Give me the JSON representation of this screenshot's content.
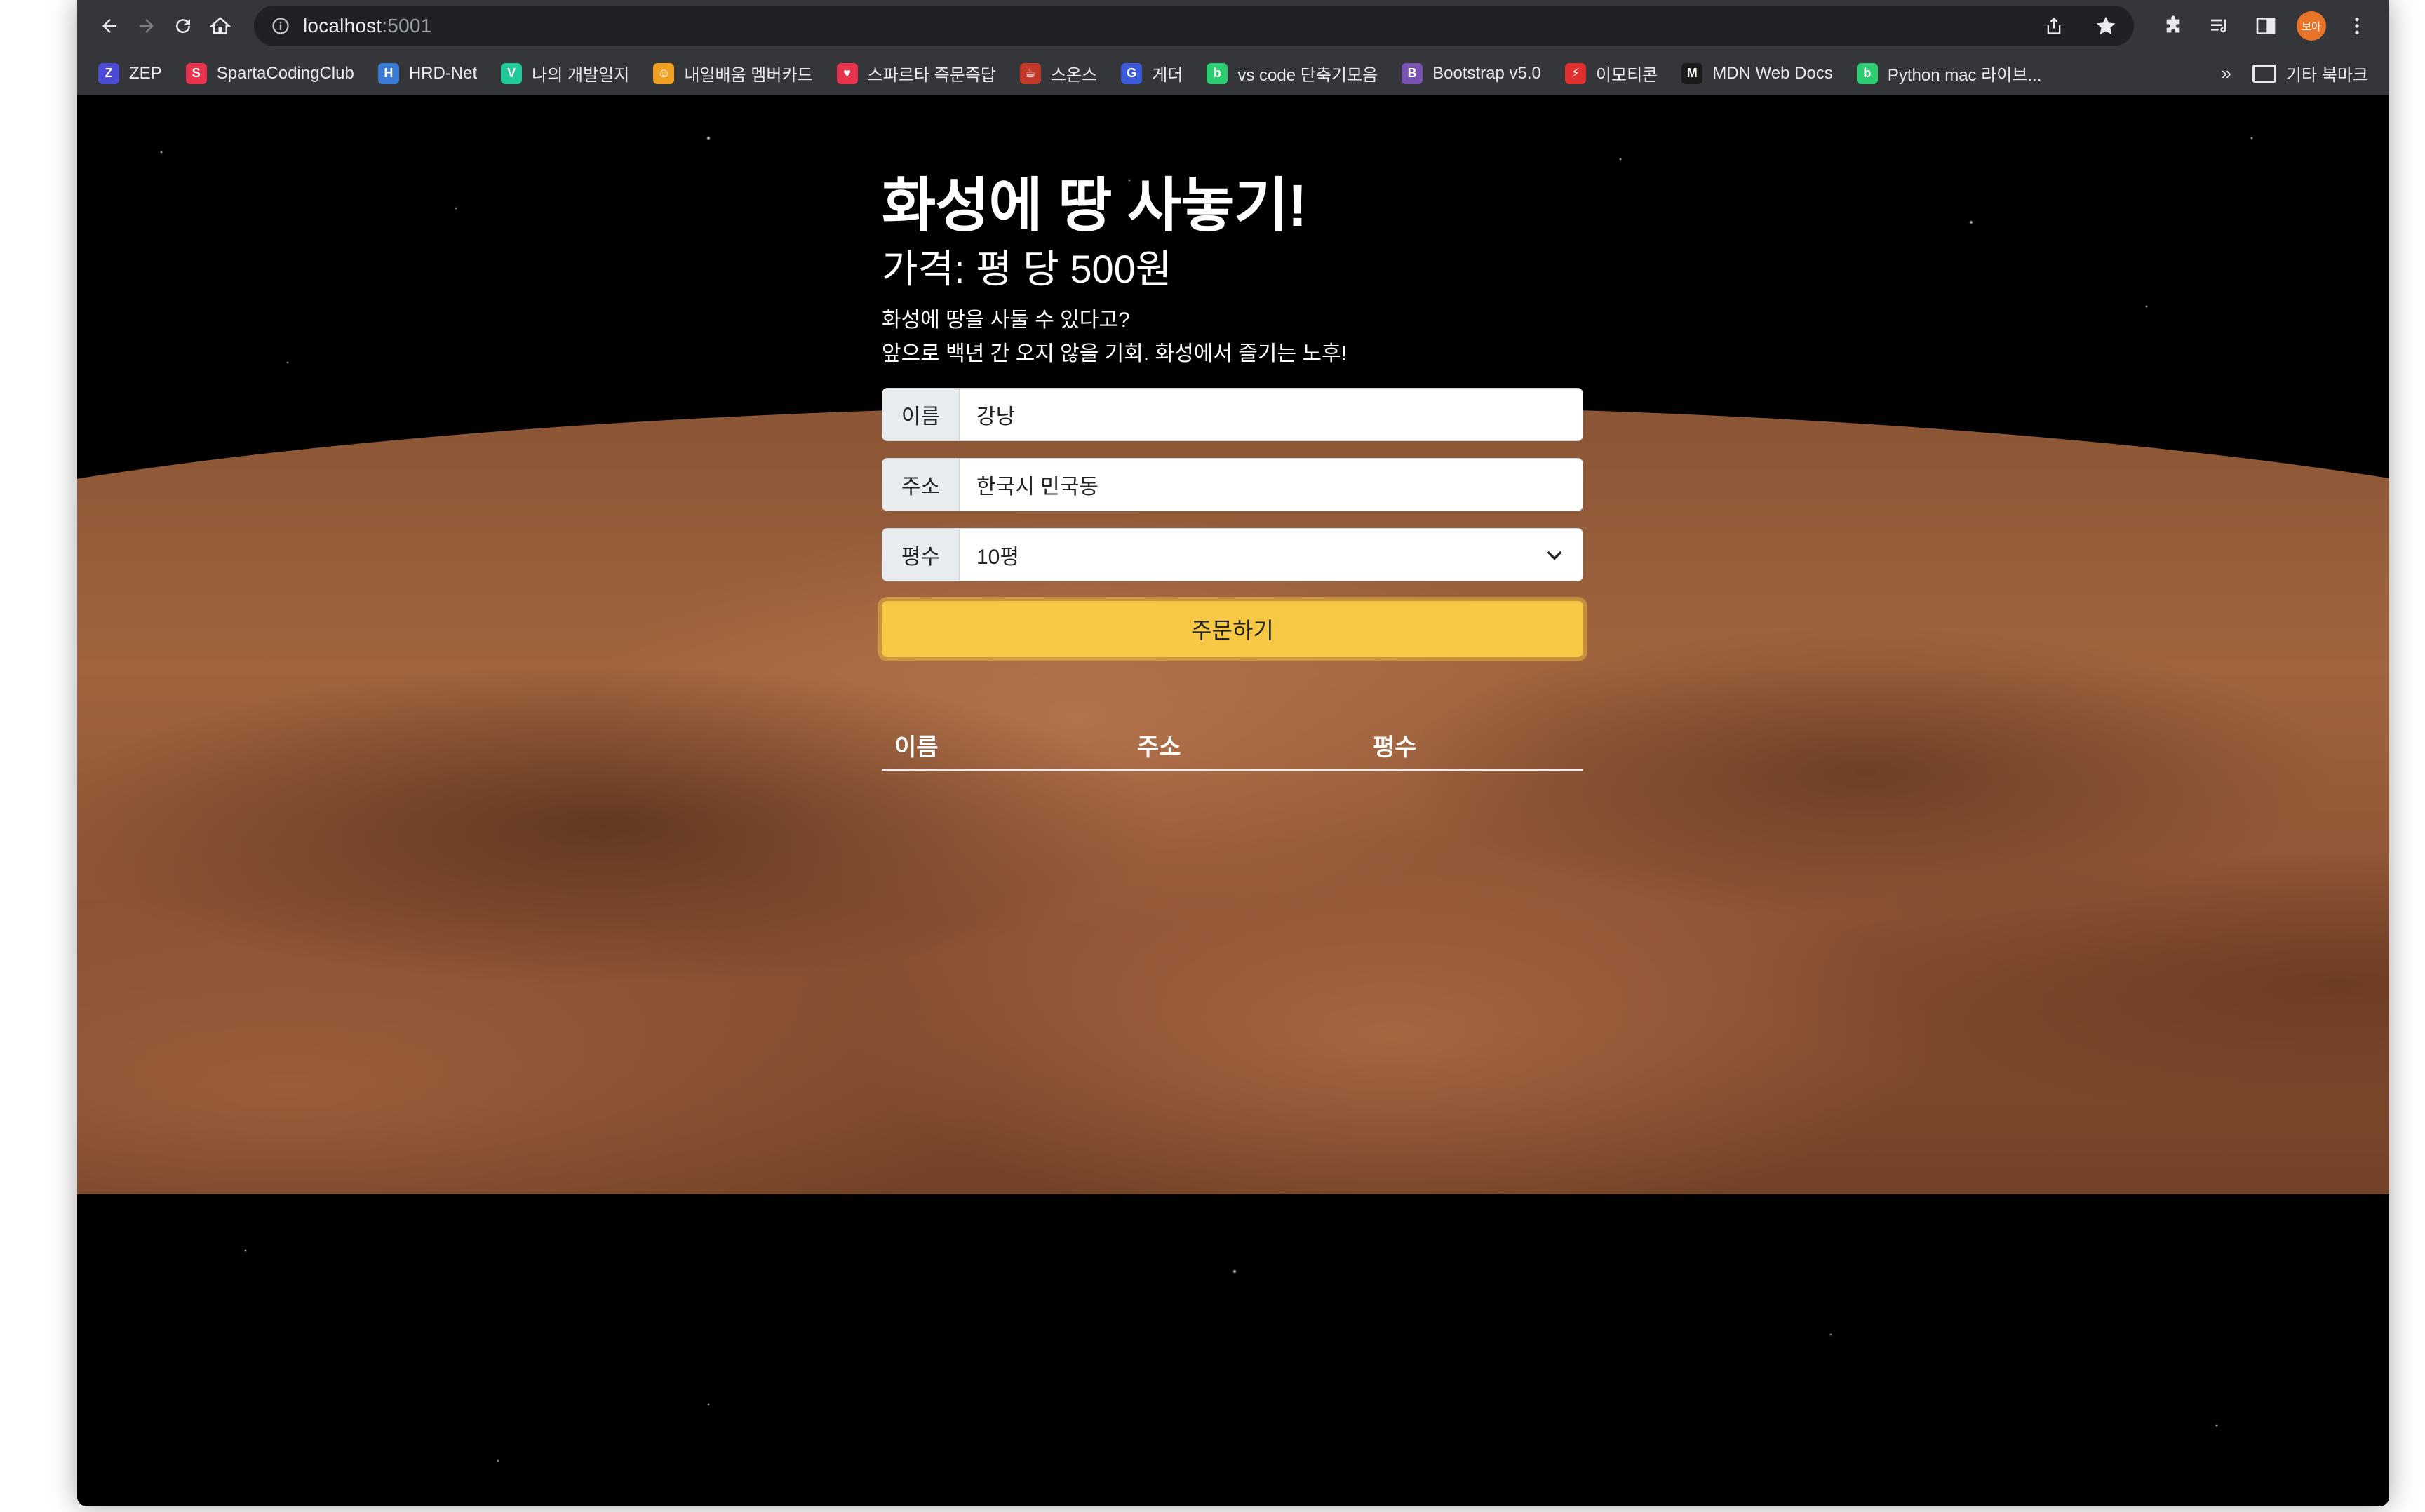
{
  "browser": {
    "url_host": "localhost",
    "url_port": ":5001",
    "profile_initials": "보아"
  },
  "bookmarks": {
    "items": [
      {
        "label": "ZEP",
        "icon": "zep-icon",
        "color": "#4b4bd6"
      },
      {
        "label": "SpartaCodingClub",
        "icon": "sparta-icon",
        "color": "#e8344e"
      },
      {
        "label": "HRD-Net",
        "icon": "hrd-icon",
        "color": "#3a7bd5"
      },
      {
        "label": "나의 개발일지",
        "icon": "velog-icon",
        "color": "#20c997"
      },
      {
        "label": "내일배움 멤버카드",
        "icon": "smile-icon",
        "color": "#f0a020"
      },
      {
        "label": "스파르타 즉문즉답",
        "icon": "heart-icon",
        "color": "#e8344e"
      },
      {
        "label": "스온스",
        "icon": "cup-icon",
        "color": "#c0392b"
      },
      {
        "label": "게더",
        "icon": "gather-icon",
        "color": "#3b5bdb"
      },
      {
        "label": "vs code 단축기모음",
        "icon": "blog-icon",
        "color": "#2ecc71"
      },
      {
        "label": "Bootstrap v5.0",
        "icon": "bootstrap-icon",
        "color": "#7952b3"
      },
      {
        "label": "이모티콘",
        "icon": "bolt-icon",
        "color": "#e03131"
      },
      {
        "label": "MDN Web Docs",
        "icon": "mdn-icon",
        "color": "#1b1b1b"
      },
      {
        "label": "Python mac 라이브...",
        "icon": "blog-icon",
        "color": "#2ecc71"
      }
    ],
    "overflow": "»",
    "other_label": "기타 북마크"
  },
  "page": {
    "title": "화성에 땅 사놓기!",
    "price": "가격: 평 당 500원",
    "desc_line1": "화성에 땅을 사둘 수 있다고?",
    "desc_line2": "앞으로 백년 간 오지 않을 기회. 화성에서 즐기는 노후!",
    "form": {
      "name_label": "이름",
      "name_value": "강낭",
      "address_label": "주소",
      "address_value": "한국시 민국동",
      "size_label": "평수",
      "size_value": "10평",
      "submit_label": "주문하기"
    },
    "table": {
      "columns": [
        "이름",
        "주소",
        "평수"
      ]
    }
  },
  "colors": {
    "accent_button": "#f6c843",
    "chrome_bar": "#35363a"
  }
}
